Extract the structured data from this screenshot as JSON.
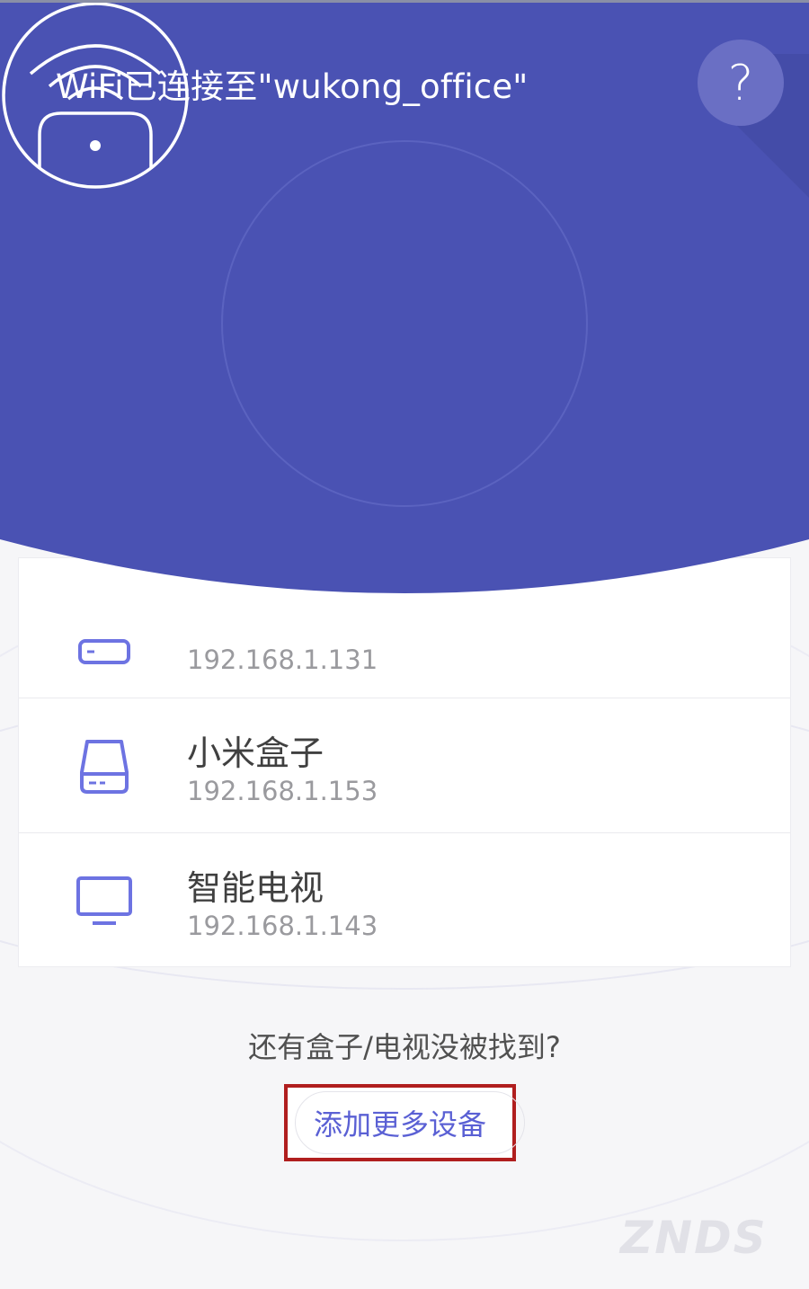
{
  "header": {
    "title": "WiFi已连接至\"wukong_office\"",
    "help_label": "?",
    "bg_color": "#4a52b3"
  },
  "devices": [
    {
      "name": "",
      "ip": "192.168.1.131",
      "icon": "box-icon"
    },
    {
      "name": "小米盒子",
      "ip": "192.168.1.153",
      "icon": "box-icon"
    },
    {
      "name": "智能电视",
      "ip": "192.168.1.143",
      "icon": "tv-icon"
    }
  ],
  "footer": {
    "not_found_text": "还有盒子/电视没被找到?",
    "add_more_label": "添加更多设备",
    "watermark": "ZNDS"
  },
  "colors": {
    "accent": "#5a60d4",
    "highlight_border": "#b01e1e"
  }
}
